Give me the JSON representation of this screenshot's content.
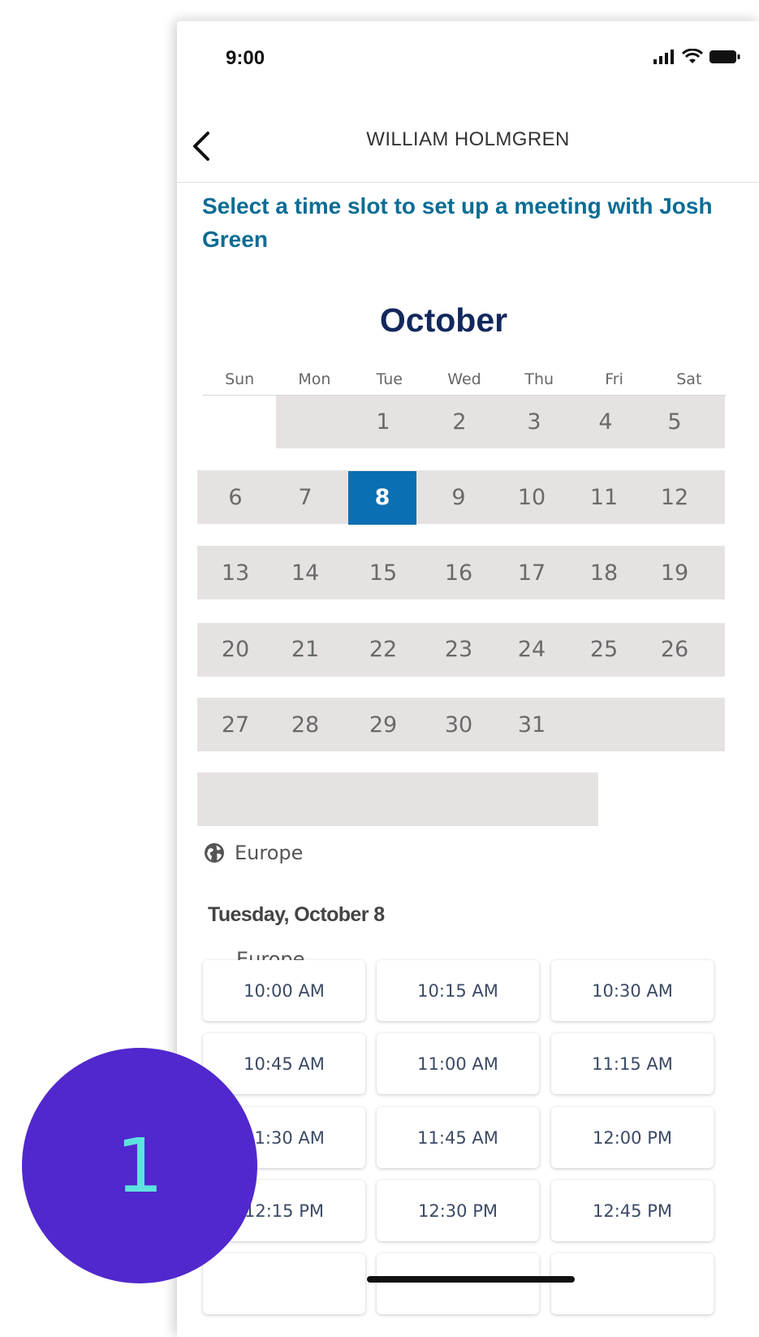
{
  "status": {
    "time": "9:00"
  },
  "nav": {
    "title": "WILLIAM HOLMGREN"
  },
  "heading": "Select a time slot to set up a meeting with Josh Green",
  "calendar": {
    "month": "October",
    "weekdays": [
      "Sun",
      "Mon",
      "Tue",
      "Wed",
      "Thu",
      "Fri",
      "Sat"
    ],
    "selected_day": "8",
    "weeks": [
      [
        "",
        "",
        "1",
        "2",
        "3",
        "4",
        "5"
      ],
      [
        "6",
        "7",
        "8",
        "9",
        "10",
        "11",
        "12"
      ],
      [
        "13",
        "14",
        "15",
        "16",
        "17",
        "18",
        "19"
      ],
      [
        "20",
        "21",
        "22",
        "23",
        "24",
        "25",
        "26"
      ],
      [
        "27",
        "28",
        "29",
        "30",
        "31",
        "",
        ""
      ]
    ]
  },
  "timezone": "Europe",
  "date_label": "Tuesday, October 8",
  "slots_timezone": "Europe",
  "slots": [
    "10:00 AM",
    "10:15 AM",
    "10:30 AM",
    "10:45 AM",
    "11:00 AM",
    "11:15 AM",
    "11:30 AM",
    "11:45 AM",
    "12:00 PM",
    "12:15 PM",
    "12:30 PM",
    "12:45 PM"
  ],
  "step_badge": "1",
  "colors": {
    "heading": "#0a6d95",
    "month": "#12285c",
    "selected_day": "#0b6fb3",
    "row_band": "#e6e2e2",
    "badge": "#5128cd",
    "badge_text": "#5ce3de"
  }
}
